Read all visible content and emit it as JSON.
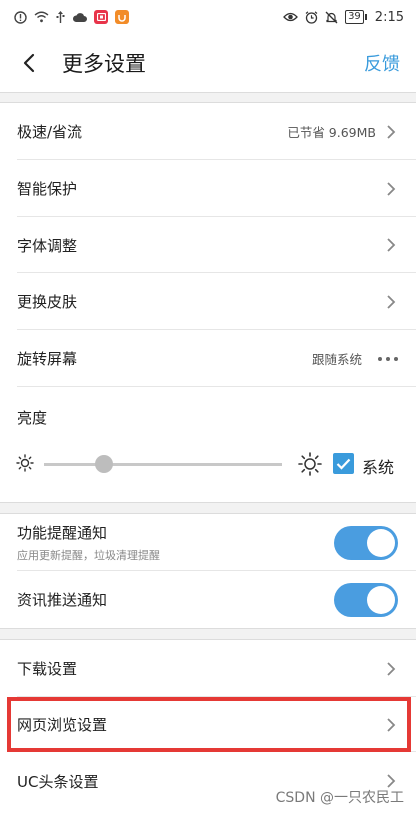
{
  "status_bar": {
    "time": "2:15",
    "battery": "39"
  },
  "header": {
    "title": "更多设置",
    "feedback": "反馈"
  },
  "settings": {
    "speed_mode": {
      "label": "极速/省流",
      "value": "已节省 9.69MB"
    },
    "smart_protect": {
      "label": "智能保护"
    },
    "font_adjust": {
      "label": "字体调整"
    },
    "change_skin": {
      "label": "更换皮肤"
    },
    "rotate_screen": {
      "label": "旋转屏幕",
      "value": "跟随系统"
    },
    "brightness": {
      "label": "亮度",
      "level": 0.25,
      "system_label": "系统",
      "system_checked": true
    }
  },
  "notifications": {
    "feature_notify": {
      "label": "功能提醒通知",
      "sub": "应用更新提醒，垃圾清理提醒",
      "on": true
    },
    "news_push": {
      "label": "资讯推送通知",
      "on": true
    }
  },
  "more": {
    "download": {
      "label": "下载设置"
    },
    "web_browse": {
      "label": "网页浏览设置"
    },
    "uc_headline": {
      "label": "UC头条设置"
    }
  },
  "watermark": "CSDN @一只农民工",
  "colors": {
    "accent": "#3a9bdc",
    "highlight": "#e53935",
    "toggle": "#4a9de0"
  }
}
